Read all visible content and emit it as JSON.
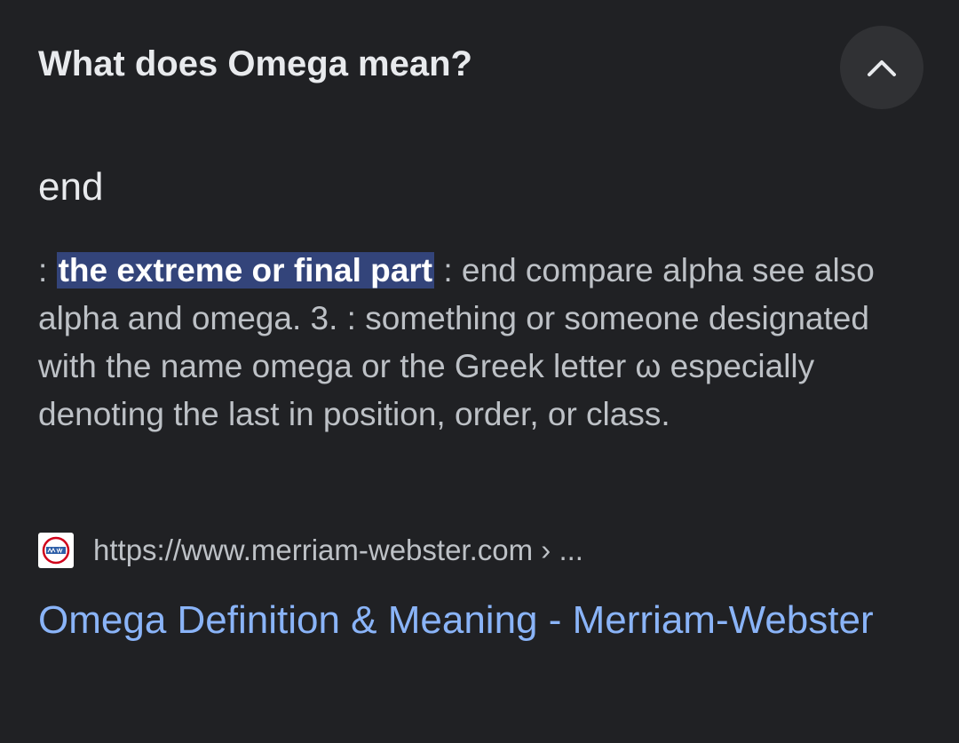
{
  "question": "What does Omega mean?",
  "collapse_icon": "chevron-up-icon",
  "answer_word": "end",
  "definition": {
    "prefix": ": ",
    "highlight": "the extreme or final part",
    "rest": " : end compare alpha see also alpha and omega. 3. : something or someone designated with the name omega or the Greek letter ω especially denoting the last in position, order, or class."
  },
  "source": {
    "favicon_icon": "merriam-webster-favicon-icon",
    "url": "https://www.merriam-webster.com › ..."
  },
  "result_title": "Omega Definition & Meaning - Merriam-Webster",
  "colors": {
    "background": "#202124",
    "highlight_bg": "#33447a",
    "link": "#8ab4f8",
    "button_bg": "#303134"
  }
}
